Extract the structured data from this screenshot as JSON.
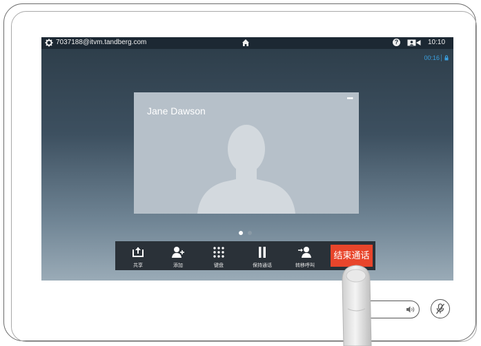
{
  "status_bar": {
    "address": "7037188@itvm.tandberg.com",
    "help": "?",
    "clock": "10:10",
    "icons": [
      "gear-icon",
      "home-icon",
      "help-icon",
      "selfview-icon"
    ]
  },
  "call": {
    "duration": "00:16",
    "encrypted": true,
    "participant_name": "Jane Dawson",
    "more": "•••",
    "page_indicator": {
      "pages": 2,
      "current": 1
    }
  },
  "toolbar": {
    "share_label": "共享",
    "add_label": "添加",
    "keypad_label": "键盘",
    "hold_label": "保持通话",
    "transfer_label": "转移呼叫",
    "end_label": "结束通话"
  },
  "colors": {
    "status_bar": "#1c2833",
    "timer": "#3aa0e0",
    "end_call": "#e8452b",
    "tile": "#b6c0c9",
    "toolbar": "#2a3138"
  }
}
